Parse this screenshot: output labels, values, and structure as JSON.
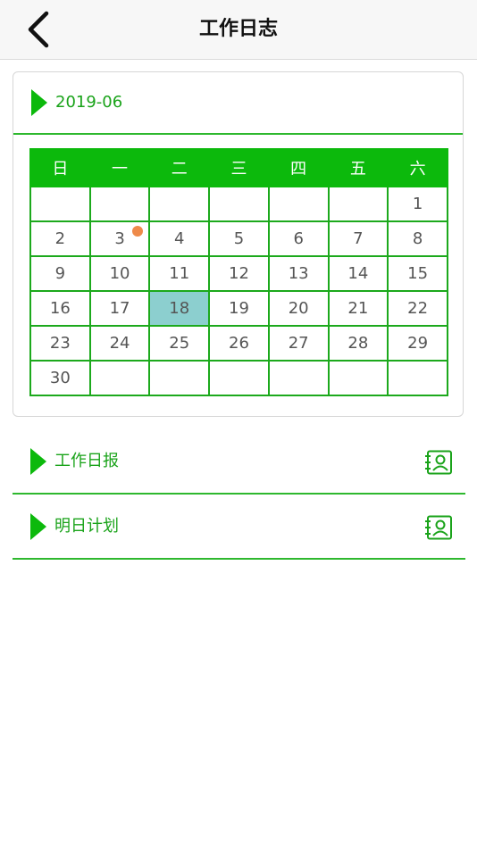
{
  "navbar": {
    "title": "工作日志",
    "back_icon": "chevron-left-icon"
  },
  "calendar": {
    "month": "2019-06",
    "weekdays": [
      "日",
      "一",
      "二",
      "三",
      "四",
      "五",
      "六"
    ],
    "weeks": [
      [
        "",
        "",
        "",
        "",
        "",
        "",
        "1"
      ],
      [
        "2",
        "3",
        "4",
        "5",
        "6",
        "7",
        "8"
      ],
      [
        "9",
        "10",
        "11",
        "12",
        "13",
        "14",
        "15"
      ],
      [
        "16",
        "17",
        "18",
        "19",
        "20",
        "21",
        "22"
      ],
      [
        "23",
        "24",
        "25",
        "26",
        "27",
        "28",
        "29"
      ],
      [
        "30",
        "",
        "",
        "",
        "",
        "",
        ""
      ]
    ],
    "selected_day": "18",
    "event_days": [
      "3"
    ],
    "colors": {
      "header": "#0cb90c",
      "grid": "#1ca91c",
      "selected": "#8ccfcf",
      "event_dot": "#ee8a4a"
    }
  },
  "sections": [
    {
      "label": "工作日报",
      "icon": "contact-card-icon"
    },
    {
      "label": "明日计划",
      "icon": "contact-card-icon"
    }
  ],
  "colors": {
    "accent": "#1aa31a"
  }
}
